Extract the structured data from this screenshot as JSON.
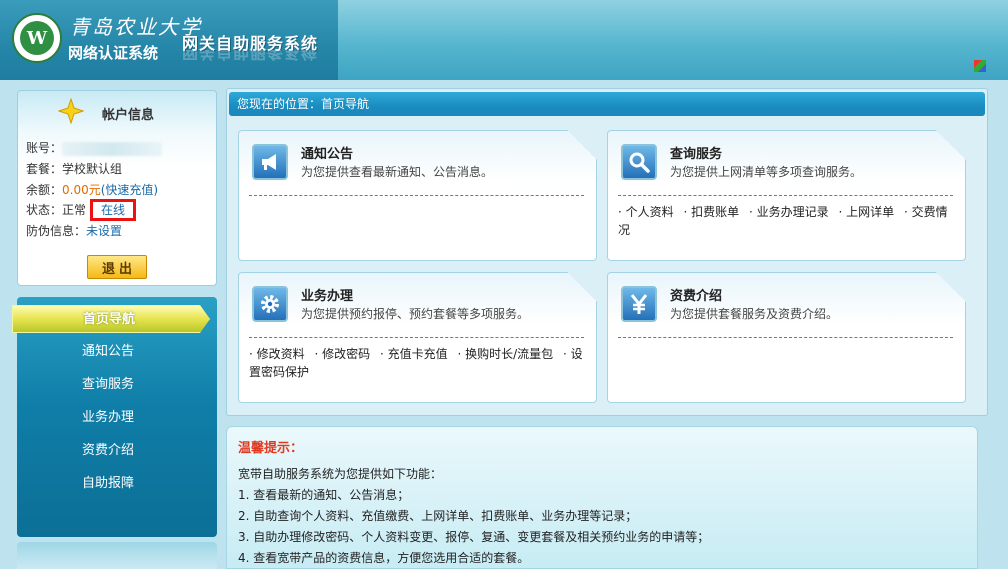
{
  "header": {
    "school_name": "青岛农业大学",
    "auth_system": "网络认证系统",
    "gateway_title": "网关自助服务系统",
    "logo_text": "W"
  },
  "account": {
    "title": "帐户信息",
    "rows": {
      "account_label": "账号：",
      "package_label": "套餐：",
      "package_value": "学校默认组",
      "balance_label": "余额：",
      "balance_value": "0.00元",
      "recharge_link": "(快速充值)",
      "status_label": "状态：",
      "status_value": "正常",
      "online_label": "在线",
      "antifraud_label": "防伪信息：",
      "antifraud_value": "未设置"
    },
    "logout_label": "退出"
  },
  "nav": {
    "items": [
      {
        "label": "首页导航",
        "active": true
      },
      {
        "label": "通知公告"
      },
      {
        "label": "查询服务"
      },
      {
        "label": "业务办理"
      },
      {
        "label": "资费介绍"
      },
      {
        "label": "自助报障"
      }
    ]
  },
  "main": {
    "breadcrumb": "您现在的位置：首页导航",
    "cards": [
      {
        "title": "通知公告",
        "desc": "为您提供查看最新通知、公告消息。",
        "icon": "megaphone-icon",
        "links": []
      },
      {
        "title": "查询服务",
        "desc": "为您提供上网清单等多项查询服务。",
        "icon": "magnifier-icon",
        "links": [
          "个人资料",
          "扣费账单",
          "业务办理记录",
          "上网详单",
          "交费情况"
        ]
      },
      {
        "title": "业务办理",
        "desc": "为您提供预约报停、预约套餐等多项服务。",
        "icon": "gear-icon",
        "links": [
          "修改资料",
          "修改密码",
          "充值卡充值",
          "换购时长/流量包",
          "设置密码保护"
        ]
      },
      {
        "title": "资费介绍",
        "desc": "为您提供套餐服务及资费介绍。",
        "icon": "yen-icon",
        "links": []
      }
    ]
  },
  "tips": {
    "title": "温馨提示：",
    "intro": "宽带自助服务系统为您提供如下功能：",
    "lines": [
      "1. 查看最新的通知、公告消息；",
      "2. 自助查询个人资料、充值缴费、上网详单、扣费账单、业务办理等记录；",
      "3. 自助办理修改密码、个人资料变更、报停、复通、变更套餐及相关预约业务的申请等；",
      "4. 查看宽带产品的资费信息，方便您选用合适的套餐。"
    ]
  },
  "colors": {
    "accent": "#1a8cc0",
    "alert": "#e11111",
    "balance": "#e06b00"
  }
}
